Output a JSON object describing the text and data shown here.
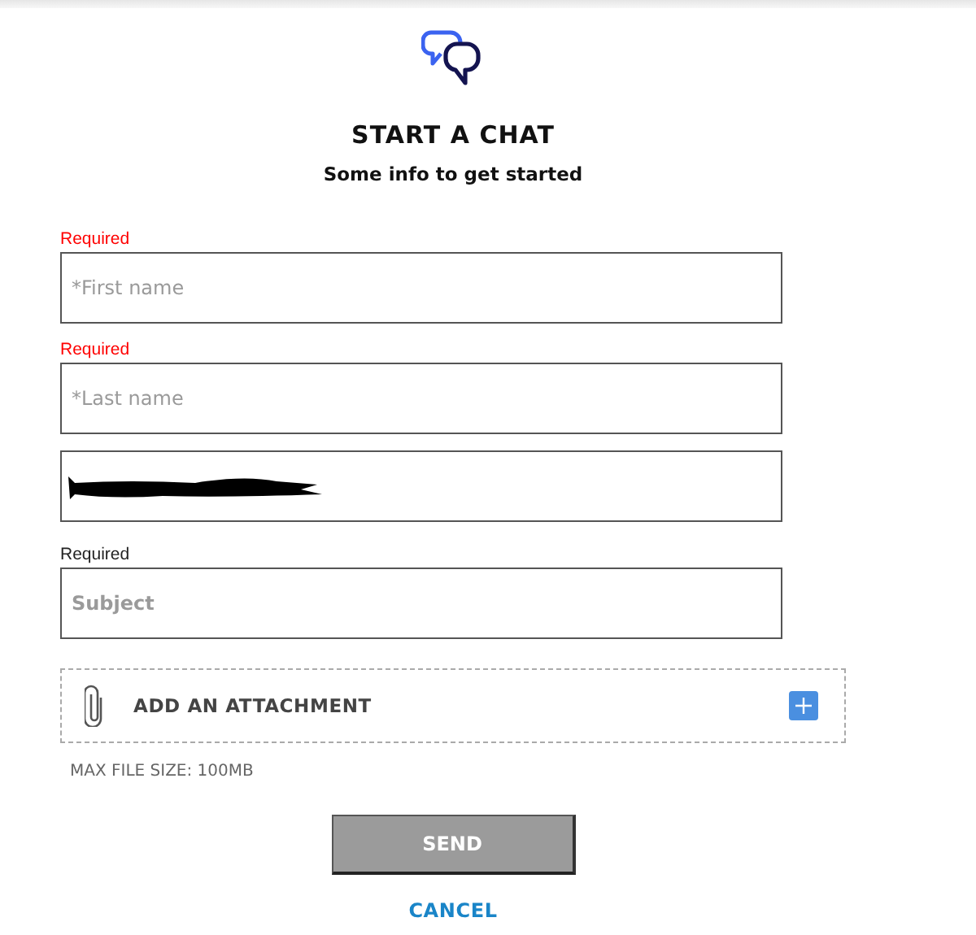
{
  "header": {
    "title": "START A CHAT",
    "subtitle": "Some info to get started"
  },
  "fields": [
    {
      "kind": "text",
      "label": {
        "text": "Required",
        "color": "#ff0000"
      },
      "placeholder": "*First name"
    },
    {
      "kind": "text",
      "label": {
        "text": "Required",
        "color": "#ff0000"
      },
      "placeholder": "*Last name"
    },
    {
      "kind": "redacted"
    },
    {
      "kind": "text",
      "label": {
        "text": "Required",
        "color": "#222222"
      },
      "placeholder": "Subject",
      "bold": true
    }
  ],
  "attachment": {
    "label": "ADD AN ATTACHMENT",
    "note": "MAX FILE SIZE: 100MB"
  },
  "buttons": {
    "send": "SEND",
    "cancel": "CANCEL"
  }
}
